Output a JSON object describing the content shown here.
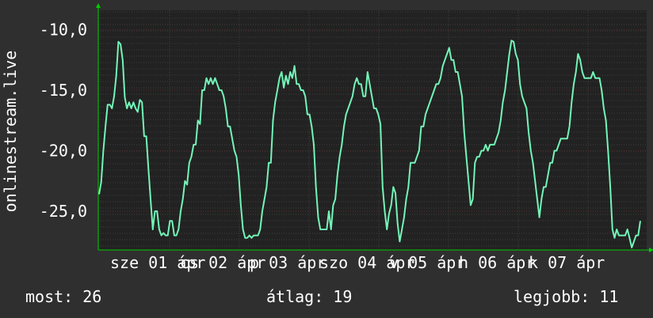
{
  "chart_data": {
    "type": "line",
    "ylabel": "onlinestream.live",
    "y_ticks": [
      {
        "value": -10,
        "label": "-10,0"
      },
      {
        "value": -15,
        "label": "-15,0"
      },
      {
        "value": -20,
        "label": "-20,0"
      },
      {
        "value": -25,
        "label": "-25,0"
      }
    ],
    "ylim": [
      -28.2,
      -8.4
    ],
    "x_tick_labels": [
      "sze 01 ápr",
      "cs 02 ápr",
      "p 03 ápr",
      "szo 04 ápr",
      "v 05 ápr",
      "h 06 ápr",
      "k 07 ápr"
    ],
    "grid": true,
    "colors": {
      "background": "#2f2f2f",
      "plot": "#222222",
      "line": "#73f5b8",
      "text": "#ffffff",
      "grid": "#3f3f3f",
      "axis": "#00cc00"
    },
    "series": [
      {
        "values": [
          -23.6,
          -22.6,
          -20.0,
          -18.0,
          -16.2,
          -16.2,
          -16.5,
          -15.5,
          -13.8,
          -11.0,
          -11.2,
          -12.5,
          -15.6,
          -16.5,
          -16.0,
          -16.5,
          -16.0,
          -16.5,
          -16.8,
          -15.8,
          -16.0,
          -18.8,
          -18.8,
          -21.5,
          -24.0,
          -26.5,
          -25.0,
          -25.0,
          -26.5,
          -27.0,
          -26.8,
          -27.0,
          -27.0,
          -25.8,
          -25.8,
          -27.0,
          -27.0,
          -26.5,
          -25.0,
          -24.0,
          -22.5,
          -22.8,
          -21.0,
          -20.5,
          -19.5,
          -19.5,
          -17.5,
          -17.8,
          -15.0,
          -15.0,
          -14.0,
          -14.5,
          -14.0,
          -14.5,
          -14.0,
          -14.5,
          -15.0,
          -15.0,
          -15.5,
          -16.5,
          -18.0,
          -18.0,
          -19.0,
          -20.0,
          -20.5,
          -22.0,
          -24.5,
          -26.5,
          -27.2,
          -27.2,
          -27.0,
          -27.2,
          -27.0,
          -27.0,
          -27.0,
          -26.5,
          -25.0,
          -24.0,
          -23.0,
          -21.0,
          -21.0,
          -17.5,
          -16.0,
          -15.0,
          -14.0,
          -13.5,
          -14.8,
          -13.8,
          -14.5,
          -13.5,
          -14.0,
          -13.0,
          -14.5,
          -14.5,
          -15.0,
          -15.0,
          -15.5,
          -17.0,
          -17.0,
          -18.0,
          -19.5,
          -23.0,
          -25.5,
          -26.5,
          -26.5,
          -26.5,
          -26.5,
          -25.0,
          -26.5,
          -24.5,
          -24.0,
          -22.0,
          -20.5,
          -19.5,
          -18.0,
          -17.0,
          -16.5,
          -16.0,
          -15.5,
          -14.5,
          -14.0,
          -14.5,
          -14.5,
          -15.5,
          -15.5,
          -13.5,
          -14.5,
          -15.5,
          -16.5,
          -16.5,
          -17.0,
          -17.8,
          -23.0,
          -25.0,
          -26.5,
          -25.2,
          -24.5,
          -23.0,
          -23.5,
          -26.0,
          -27.5,
          -26.5,
          -25.5,
          -24.0,
          -23.0,
          -21.0,
          -21.0,
          -21.0,
          -20.5,
          -20.0,
          -18.0,
          -18.0,
          -17.0,
          -16.5,
          -16.0,
          -15.5,
          -15.0,
          -14.5,
          -14.5,
          -14.0,
          -13.0,
          -12.5,
          -12.0,
          -11.5,
          -12.5,
          -12.5,
          -13.5,
          -13.5,
          -14.5,
          -15.5,
          -18.5,
          -20.5,
          -22.5,
          -24.5,
          -24.0,
          -21.0,
          -20.5,
          -20.5,
          -20.0,
          -20.0,
          -19.5,
          -20.0,
          -19.5,
          -19.5,
          -19.5,
          -19.0,
          -18.5,
          -17.5,
          -16.0,
          -15.0,
          -13.5,
          -12.0,
          -10.9,
          -11.0,
          -12.0,
          -12.5,
          -14.5,
          -15.5,
          -16.0,
          -16.5,
          -18.5,
          -20.0,
          -21.0,
          -22.5,
          -24.0,
          -25.5,
          -24.0,
          -23.0,
          -23.0,
          -22.0,
          -21.0,
          -21.0,
          -20.0,
          -20.0,
          -19.5,
          -19.0,
          -19.0,
          -19.0,
          -19.0,
          -18.0,
          -16.0,
          -14.5,
          -13.5,
          -12.0,
          -12.5,
          -13.5,
          -14.0,
          -14.0,
          -14.0,
          -14.0,
          -13.5,
          -14.0,
          -14.0,
          -14.0,
          -15.0,
          -16.5,
          -17.5,
          -20.0,
          -23.0,
          -26.5,
          -27.2,
          -26.5,
          -27.0,
          -27.0,
          -27.0,
          -27.0,
          -26.5,
          -27.2,
          -28.0,
          -27.5,
          -27.0,
          -27.0,
          -25.8
        ]
      }
    ],
    "stats": {
      "now": "most: 26",
      "avg": "átlag: 19",
      "best": "legjobb: 11"
    }
  }
}
